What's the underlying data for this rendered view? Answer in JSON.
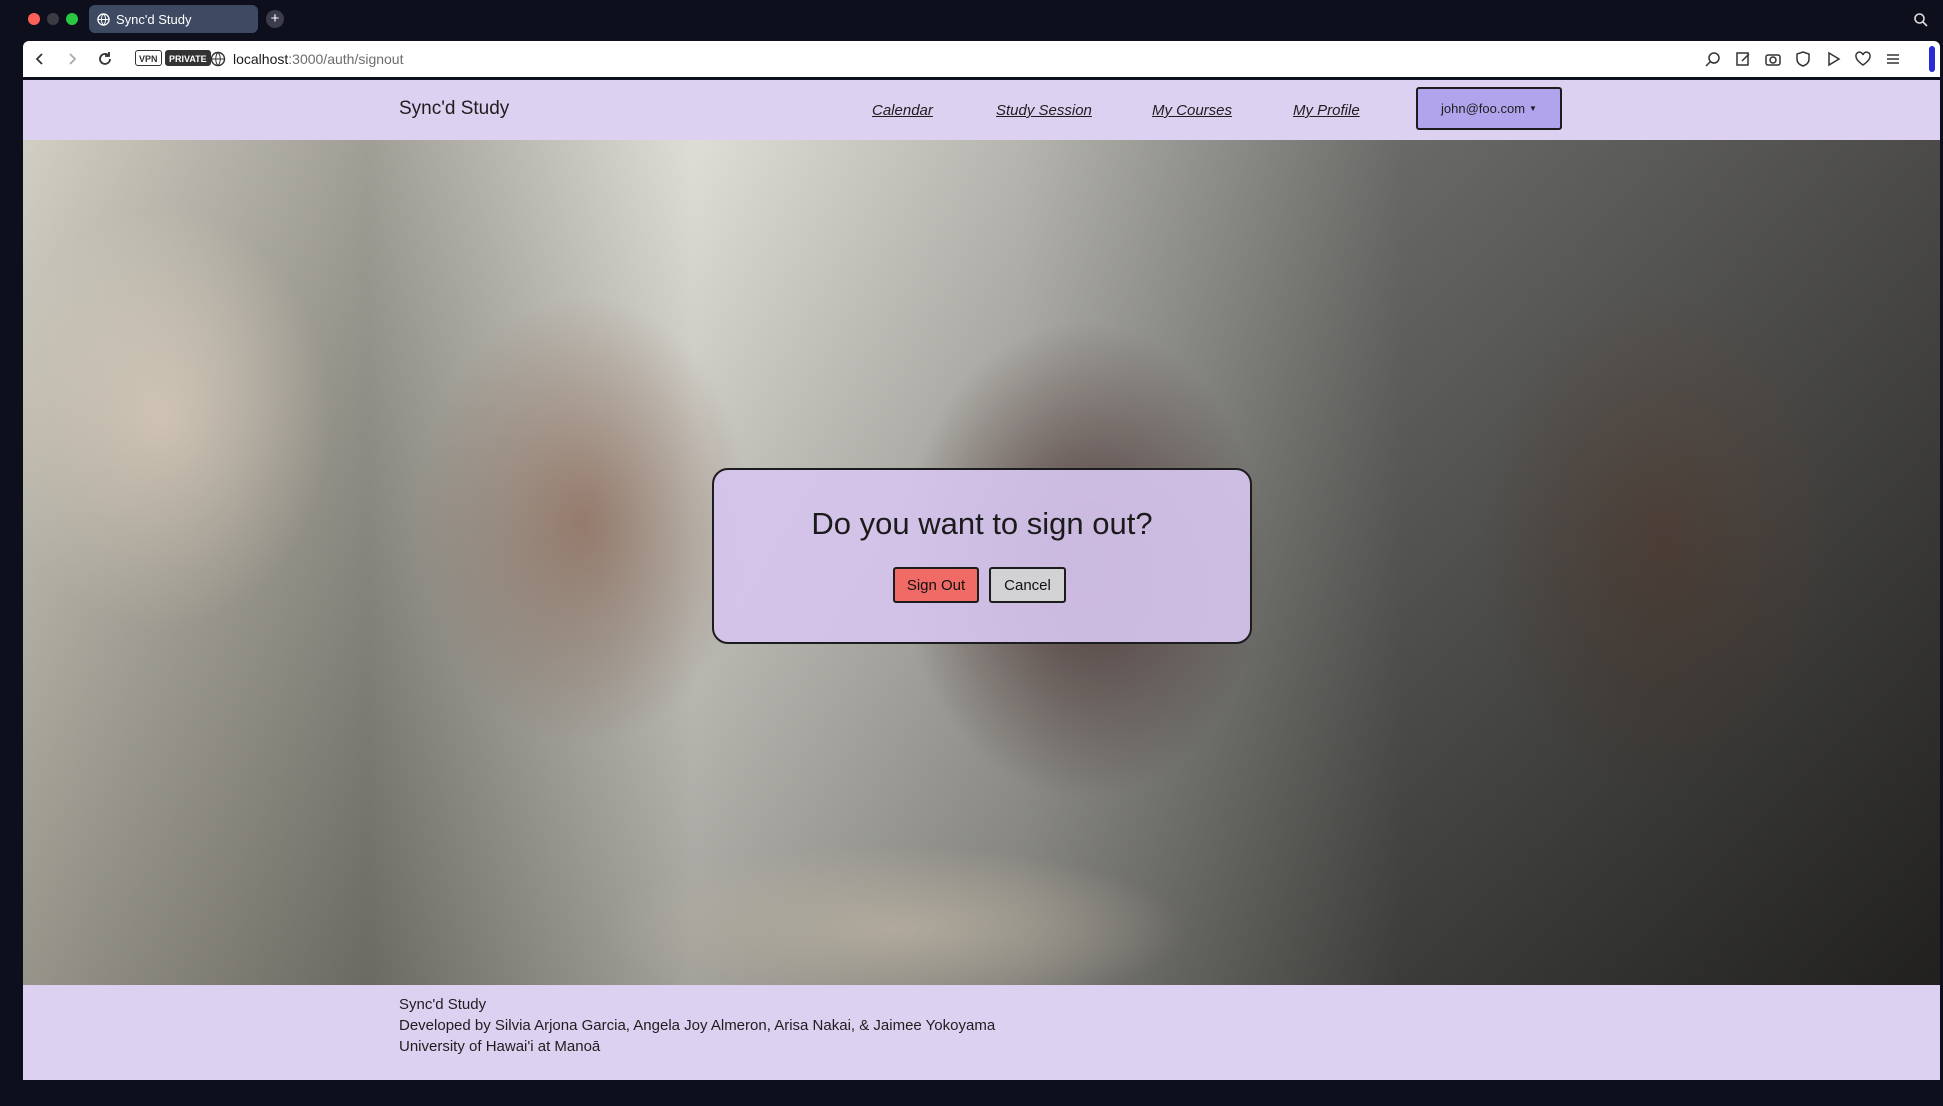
{
  "browser": {
    "tab_title": "Sync'd Study",
    "new_tab_symbol": "+",
    "vpn_badge": "VPN",
    "private_badge": "PRIVATE",
    "url_host": "localhost",
    "url_rest": ":3000/auth/signout"
  },
  "navbar": {
    "brand": "Sync'd Study",
    "links": [
      "Calendar",
      "Study Session",
      "My Courses",
      "My Profile"
    ],
    "user_menu": "john@foo.com"
  },
  "modal": {
    "title": "Do you want to sign out?",
    "signout_label": "Sign Out",
    "cancel_label": "Cancel"
  },
  "footer": {
    "line1": "Sync'd Study",
    "line2": "Developed by Silvia Arjona Garcia, Angela Joy Almeron, Arisa Nakai, & Jaimee Yokoyama",
    "line3": "University of Hawai'i at Manoā"
  },
  "colors": {
    "nav_bg": "#ddd1f2",
    "user_btn": "#b1a4ed",
    "signout_btn": "#f06a66",
    "cancel_btn": "#d2d2d4"
  }
}
